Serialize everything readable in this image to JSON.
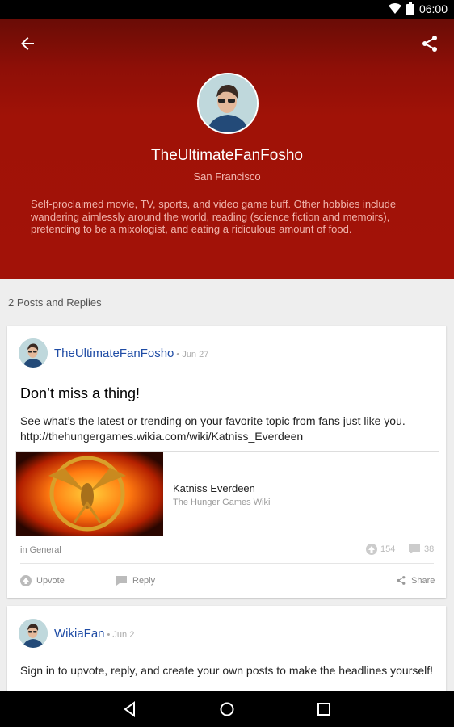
{
  "status_bar": {
    "time": "06:00",
    "icons": [
      "wifi-icon",
      "battery-icon"
    ]
  },
  "header": {
    "back_icon": "arrow-back-icon",
    "share_icon": "share-icon"
  },
  "profile": {
    "username": "TheUltimateFanFosho",
    "location": "San Francisco",
    "bio": "Self-proclaimed movie, TV, sports, and video game buff. Other hobbies include wandering aimlessly around the world, reading (science fiction and memoirs), pretending to be a mixologist, and eating a ridiculous amount of food."
  },
  "feed": {
    "count_label": "2 Posts and Replies",
    "posts": [
      {
        "author": "TheUltimateFanFosho",
        "date": "• Jun 27",
        "title": "Don’t miss a thing!",
        "body": "See what’s the latest or trending on your favorite topic from fans just like you. http://thehungergames.wikia.com/wiki/Katniss_Everdeen",
        "link": {
          "title": "Katniss Everdeen",
          "source": "The Hunger Games Wiki"
        },
        "category": "in General",
        "upvotes": "154",
        "replies": "38",
        "actions": {
          "upvote": "Upvote",
          "reply": "Reply",
          "share": "Share"
        }
      },
      {
        "author": "WikiaFan",
        "date": "• Jun 2",
        "body": "Sign in to upvote, reply, and create your own posts to make the headlines yourself!"
      }
    ]
  },
  "colors": {
    "hero": "#a21208",
    "link": "#1f4ca5",
    "background": "#eeeeee"
  }
}
